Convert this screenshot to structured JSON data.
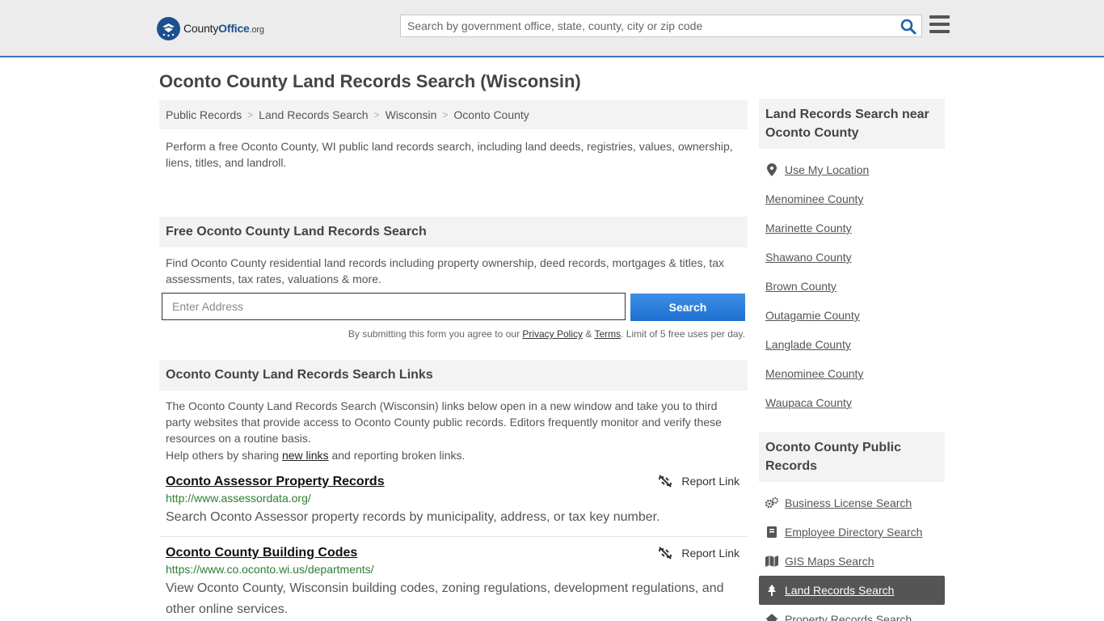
{
  "header": {
    "logo_county": "County",
    "logo_office": "Office",
    "logo_org": ".org",
    "search_placeholder": "Search by government office, state, county, city or zip code"
  },
  "page_title": "Oconto County Land Records Search (Wisconsin)",
  "breadcrumb": [
    "Public Records",
    "Land Records Search",
    "Wisconsin",
    "Oconto County"
  ],
  "intro": "Perform a free Oconto County, WI public land records search, including land deeds, registries, values, ownership, liens, titles, and landroll.",
  "free_search": {
    "heading": "Free Oconto County Land Records Search",
    "description": "Find Oconto County residential land records including property ownership, deed records, mortgages & titles, tax assessments, tax rates, valuations & more.",
    "address_placeholder": "Enter Address",
    "button": "Search",
    "disclaimer_prefix": "By submitting this form you agree to our ",
    "privacy": "Privacy Policy",
    "amp": " & ",
    "terms": "Terms",
    "disclaimer_suffix": ". Limit of 5 free uses per day."
  },
  "links_section": {
    "heading": "Oconto County Land Records Search Links",
    "description": "The Oconto County Land Records Search (Wisconsin) links below open in a new window and take you to third party websites that provide access to Oconto County public records. Editors frequently monitor and verify these resources on a routine basis.",
    "help_prefix": "Help others by sharing ",
    "help_link": "new links",
    "help_suffix": " and reporting broken links.",
    "report_label": "Report Link",
    "items": [
      {
        "title": "Oconto Assessor Property Records",
        "url": "http://www.assessordata.org/",
        "desc": "Search Oconto Assessor property records by municipality, address, or tax key number."
      },
      {
        "title": "Oconto County Building Codes",
        "url": "https://www.co.oconto.wi.us/departments/",
        "desc": "View Oconto County, Wisconsin building codes, zoning regulations, development regulations, and other online services."
      }
    ]
  },
  "sidebar": {
    "nearby_heading": "Land Records Search near Oconto County",
    "use_location": "Use My Location",
    "nearby": [
      "Menominee County",
      "Marinette County",
      "Shawano County",
      "Brown County",
      "Outagamie County",
      "Langlade County",
      "Menominee County",
      "Waupaca County"
    ],
    "records_heading": "Oconto County Public Records",
    "records": [
      {
        "label": "Business License Search",
        "icon": "gears-icon"
      },
      {
        "label": "Employee Directory Search",
        "icon": "book-icon"
      },
      {
        "label": "GIS Maps Search",
        "icon": "map-icon"
      },
      {
        "label": "Land Records Search",
        "icon": "tree-icon",
        "active": true
      },
      {
        "label": "Property Records Search",
        "icon": "house-icon"
      }
    ]
  },
  "colors": {
    "accent_blue": "#1d6fd1",
    "url_green": "#2e7d32",
    "active_bg": "#555555"
  }
}
